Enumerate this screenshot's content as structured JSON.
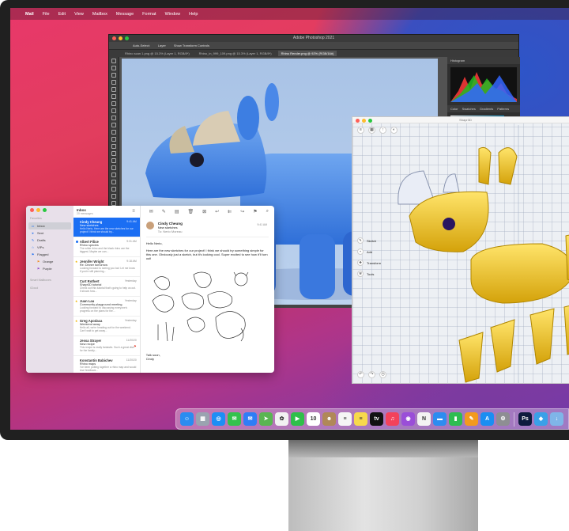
{
  "menubar": {
    "apple": "",
    "items": [
      "Mail",
      "File",
      "Edit",
      "View",
      "Mailbox",
      "Message",
      "Format",
      "Window",
      "Help"
    ]
  },
  "photoshop": {
    "window_title": "Adobe Photoshop 2021",
    "options": {
      "auto_select": "Auto-Select:",
      "layer": "Layer",
      "transform": "Show Transform Controls"
    },
    "tabs": [
      "Rhino scan 1.png @ 15.3% (Layer 1, RGB/8*)",
      "Rhino_in_999_109.png @ 15.3% (Layer 1, RGB/8*)",
      "Rhino Render.png @ 92% (RGB/16#)"
    ],
    "panels": {
      "histogram": "Histogram",
      "color_tabs": [
        "Color",
        "Swatches",
        "Gradients",
        "Patterns"
      ]
    }
  },
  "shapr": {
    "window_title": "Shapr3D",
    "menu": [
      "Sketch",
      "Add",
      "Transform",
      "Tools"
    ]
  },
  "mail": {
    "sidebar": {
      "favorites": "Favorites",
      "items": [
        {
          "icon": "▭",
          "label": "Inbox"
        },
        {
          "icon": "➤",
          "label": "Sent"
        },
        {
          "icon": "✎",
          "label": "Drafts"
        },
        {
          "icon": "☆",
          "label": "VIPs"
        },
        {
          "icon": "⚑",
          "label": "Flagged"
        }
      ],
      "flagged_sub": [
        {
          "label": "Orange",
          "color": "#f08a1c"
        },
        {
          "label": "Purple",
          "color": "#8e44c9"
        }
      ],
      "smart_mailboxes": "Smart Mailboxes",
      "icloud": "iCloud"
    },
    "list": {
      "title": "Inbox",
      "count": "20 messages",
      "messages": [
        {
          "from": "Cindy Cheung",
          "date": "9:41 AM",
          "subject": "New sketches",
          "preview": "Hello Nerio, Here are the new sketches for our project! I think we should try..."
        },
        {
          "from": "Albert Filice",
          "date": "9:31 AM",
          "subject": "Rhino species",
          "preview": "The white rhino and the black rhino are the biggest. Maybe we can..."
        },
        {
          "from": "Jennifer Wright",
          "date": "9:18 AM",
          "subject": "Re: Dinner tomorrow",
          "preview": "Looking forward to seeing you too! Let me know if you're still planning..."
        },
        {
          "from": "Curt Rothert",
          "date": "Yesterday",
          "subject": "Shapr3D tutorial",
          "preview": "Check out this tutorial that's going to help us out. It shows how..."
        },
        {
          "from": "Juan Lau",
          "date": "Yesterday",
          "subject": "Community playground meeting",
          "preview": "Looking forward to discussing everyone's progress on the plans for the..."
        },
        {
          "from": "Greg Apodaca",
          "date": "Yesterday",
          "subject": "Weekend away",
          "preview": "Hello all, we're heading out for the weekend. Can't wait to get away..."
        },
        {
          "from": "Jessa Strayer",
          "date": "11/20/20",
          "subject": "New recipe",
          "preview": "This recipe is really fantastic. Such a great dish for the family..."
        },
        {
          "from": "Konstantin Babichev",
          "date": "11/20/20",
          "subject": "Rhino maps",
          "preview": "I've been putting together a rhino map and would love feedback..."
        }
      ]
    },
    "reader": {
      "from": "Cindy Cheung",
      "subject": "New sketches",
      "to": "To: Nerio Moreau",
      "date": "9:41 AM",
      "greeting": "Hello Nerio,",
      "body": "Here are the new sketches for our project! I think we should try something simple for this one. Obviously just a sketch, but it's looking cool. Super excited to see how it'll turn out!",
      "signoff": "Talk soon,",
      "signature": "Cindy"
    }
  },
  "dock": {
    "apps": [
      {
        "name": "finder-icon",
        "color": "#2a8cf0",
        "glyph": "☺"
      },
      {
        "name": "launchpad-icon",
        "color": "#9aa3b0",
        "glyph": "▦"
      },
      {
        "name": "safari-icon",
        "color": "#1d8ef5",
        "glyph": "◎"
      },
      {
        "name": "messages-icon",
        "color": "#33c24d",
        "glyph": "✉"
      },
      {
        "name": "mail-icon",
        "color": "#2f7df6",
        "glyph": "✉"
      },
      {
        "name": "maps-icon",
        "color": "#5ab552",
        "glyph": "➤"
      },
      {
        "name": "photos-icon",
        "color": "#f2f2f2",
        "glyph": "✿"
      },
      {
        "name": "facetime-icon",
        "color": "#2fbf4a",
        "glyph": "▶"
      },
      {
        "name": "calendar-icon",
        "color": "#ffffff",
        "glyph": "10"
      },
      {
        "name": "contacts-icon",
        "color": "#b08858",
        "glyph": "☻"
      },
      {
        "name": "reminders-icon",
        "color": "#f5f5f5",
        "glyph": "≡"
      },
      {
        "name": "notes-icon",
        "color": "#f7d94c",
        "glyph": "≡"
      },
      {
        "name": "apple-tv-icon",
        "color": "#111111",
        "glyph": "tv"
      },
      {
        "name": "music-icon",
        "color": "#f3425b",
        "glyph": "♫"
      },
      {
        "name": "podcasts-icon",
        "color": "#9a4ed8",
        "glyph": "◉"
      },
      {
        "name": "news-icon",
        "color": "#f3f3f3",
        "glyph": "N"
      },
      {
        "name": "keynote-icon",
        "color": "#2d8cf0",
        "glyph": "▬"
      },
      {
        "name": "numbers-icon",
        "color": "#2ebd52",
        "glyph": "▮"
      },
      {
        "name": "pages-icon",
        "color": "#f39a1e",
        "glyph": "✎"
      },
      {
        "name": "app-store-icon",
        "color": "#1a8ef2",
        "glyph": "A"
      },
      {
        "name": "system-preferences-icon",
        "color": "#8e8e93",
        "glyph": "⚙"
      },
      {
        "name": "photoshop-icon",
        "color": "#0d1b3e",
        "glyph": "Ps"
      },
      {
        "name": "shapr3d-icon",
        "color": "#3aa0e8",
        "glyph": "◆"
      },
      {
        "name": "downloads-icon",
        "color": "#7fb5e8",
        "glyph": "↓"
      }
    ]
  }
}
